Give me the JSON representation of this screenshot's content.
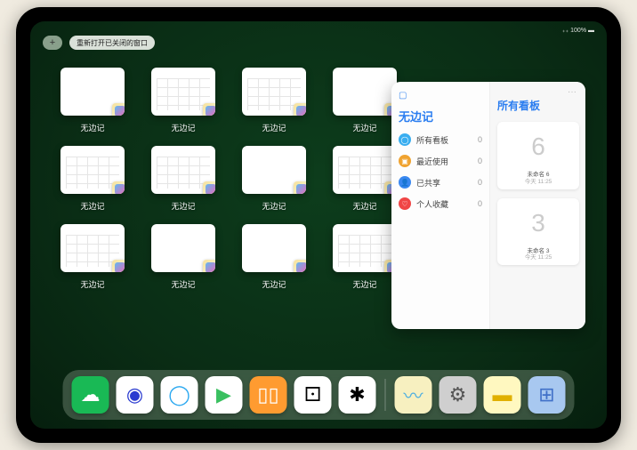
{
  "status": {
    "indicator": "₊₊ 100% ▬"
  },
  "topbar": {
    "plus": "+",
    "reopen_label": "重新打开已关闭的窗口"
  },
  "appThumbs": [
    {
      "label": "无边记",
      "style": "blank"
    },
    {
      "label": "无边记",
      "style": "cal"
    },
    {
      "label": "无边记",
      "style": "cal"
    },
    {
      "label": "无边记",
      "style": "blank"
    },
    {
      "label": "无边记",
      "style": "cal"
    },
    {
      "label": "无边记",
      "style": "cal"
    },
    {
      "label": "无边记",
      "style": "blank"
    },
    {
      "label": "无边记",
      "style": "cal"
    },
    {
      "label": "无边记",
      "style": "cal"
    },
    {
      "label": "无边记",
      "style": "blank"
    },
    {
      "label": "无边记",
      "style": "blank"
    },
    {
      "label": "无边记",
      "style": "cal"
    }
  ],
  "panel": {
    "icon": "▢",
    "more": "···",
    "sidebar_title": "无边记",
    "right_title": "所有看板",
    "items": [
      {
        "icon_bg": "#3aaef0",
        "glyph": "◯",
        "label": "所有看板",
        "count": "0"
      },
      {
        "icon_bg": "#f0a330",
        "glyph": "▣",
        "label": "最近使用",
        "count": "0"
      },
      {
        "icon_bg": "#3a88f0",
        "glyph": "👤",
        "label": "已共享",
        "count": "0"
      },
      {
        "icon_bg": "#f04545",
        "glyph": "♡",
        "label": "个人收藏",
        "count": "0"
      }
    ],
    "boards": [
      {
        "glyph": "6",
        "name": "未命名 6",
        "time": "今天 11:25"
      },
      {
        "glyph": "3",
        "name": "未命名 3",
        "time": "今天 11:25"
      }
    ]
  },
  "dock": [
    {
      "name": "wechat-icon",
      "bg": "#19b955",
      "glyph": "☁",
      "fg": "#fff"
    },
    {
      "name": "browser-icon",
      "bg": "#ffffff",
      "glyph": "◉",
      "fg": "#2a3bd0"
    },
    {
      "name": "qqbrowser-icon",
      "bg": "#ffffff",
      "glyph": "◯",
      "fg": "#2aa8f0"
    },
    {
      "name": "play-icon",
      "bg": "#ffffff",
      "glyph": "▶",
      "fg": "#3ac060"
    },
    {
      "name": "books-icon",
      "bg": "#ff9b30",
      "glyph": "▯▯",
      "fg": "#fff"
    },
    {
      "name": "dice-icon",
      "bg": "#ffffff",
      "glyph": "⚀",
      "fg": "#000"
    },
    {
      "name": "graph-icon",
      "bg": "#ffffff",
      "glyph": "✱",
      "fg": "#000"
    },
    {
      "sep": true
    },
    {
      "name": "freeform-icon",
      "bg": "#f7f0c0",
      "glyph": "〰",
      "fg": "#50b0e0"
    },
    {
      "name": "settings-icon",
      "bg": "#cfcfcf",
      "glyph": "⚙",
      "fg": "#555"
    },
    {
      "name": "notes-icon",
      "bg": "#fff8c0",
      "glyph": "▬",
      "fg": "#e0b000"
    },
    {
      "name": "apps-icon",
      "bg": "#a8c8f0",
      "glyph": "⊞",
      "fg": "#4070c8"
    }
  ]
}
